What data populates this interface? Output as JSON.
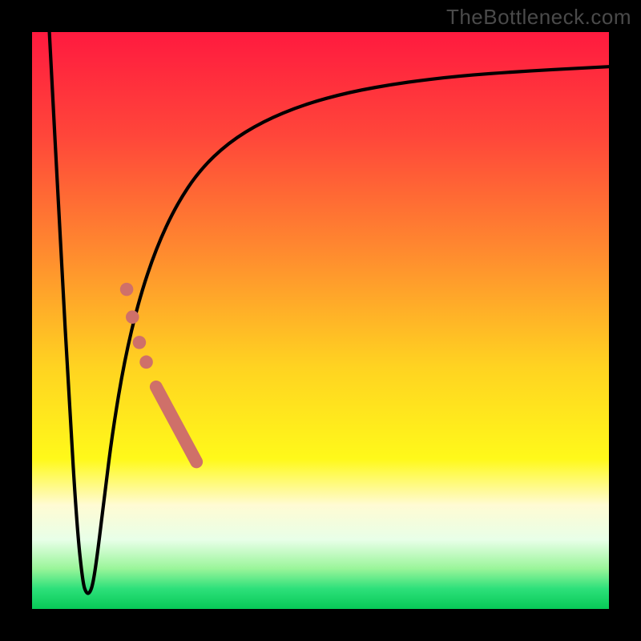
{
  "attribution": "TheBottleneck.com",
  "colors": {
    "frame": "#000000",
    "attribution_text": "#4a4a4a",
    "curve_stroke": "#000000",
    "marker_fill": "#cf7069",
    "gradient_stops": [
      {
        "offset": 0.0,
        "color": "#ff1a3f"
      },
      {
        "offset": 0.18,
        "color": "#ff463a"
      },
      {
        "offset": 0.38,
        "color": "#ff8a2f"
      },
      {
        "offset": 0.58,
        "color": "#ffd321"
      },
      {
        "offset": 0.74,
        "color": "#fff91a"
      },
      {
        "offset": 0.82,
        "color": "#fffbd3"
      },
      {
        "offset": 0.88,
        "color": "#e8ffe8"
      },
      {
        "offset": 0.93,
        "color": "#9af59a"
      },
      {
        "offset": 0.965,
        "color": "#2de07a"
      },
      {
        "offset": 1.0,
        "color": "#07c957"
      }
    ]
  },
  "chart_data": {
    "type": "line",
    "title": "",
    "xlabel": "",
    "ylabel": "",
    "xlim": [
      0,
      100
    ],
    "ylim": [
      0,
      100
    ],
    "grid": false,
    "series": [
      {
        "name": "bottleneck-curve",
        "x": [
          3.0,
          5.0,
          6.5,
          7.8,
          8.8,
          9.4,
          10.0,
          10.6,
          11.4,
          12.6,
          14.0,
          16.0,
          18.5,
          21.5,
          25.0,
          29.0,
          34.0,
          40.0,
          47.0,
          55.0,
          64.0,
          74.0,
          85.0,
          96.0,
          100.0
        ],
        "y": [
          100.0,
          62.0,
          35.0,
          14.0,
          4.5,
          2.7,
          2.7,
          4.5,
          10.0,
          20.0,
          31.0,
          43.0,
          53.5,
          62.5,
          70.0,
          76.0,
          80.8,
          84.5,
          87.4,
          89.6,
          91.2,
          92.4,
          93.2,
          93.8,
          94.0
        ]
      }
    ],
    "markers": {
      "note": "salmon dots on rising limb",
      "bar": {
        "x0": 21.5,
        "y0": 38.5,
        "x1": 28.5,
        "y1": 25.5,
        "width": 2.2
      },
      "dots": [
        {
          "x": 19.8,
          "y": 42.8,
          "r": 1.15
        },
        {
          "x": 18.6,
          "y": 46.2,
          "r": 1.15
        },
        {
          "x": 17.4,
          "y": 50.6,
          "r": 1.15
        },
        {
          "x": 16.4,
          "y": 55.4,
          "r": 1.15
        }
      ]
    }
  }
}
